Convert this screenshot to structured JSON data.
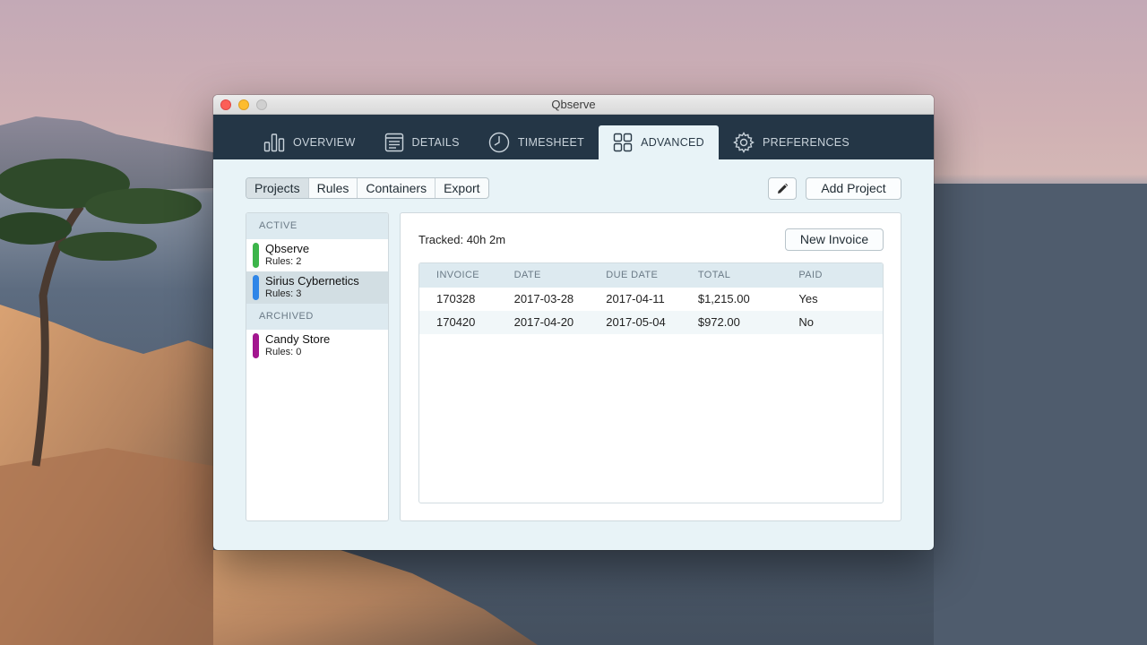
{
  "window": {
    "title": "Qbserve"
  },
  "nav": {
    "tabs": [
      {
        "label": "OVERVIEW",
        "icon": "bar-chart-icon"
      },
      {
        "label": "DETAILS",
        "icon": "document-list-icon"
      },
      {
        "label": "TIMESHEET",
        "icon": "clock-icon"
      },
      {
        "label": "ADVANCED",
        "icon": "grid-icon"
      },
      {
        "label": "PREFERENCES",
        "icon": "gear-icon"
      }
    ],
    "active": "ADVANCED"
  },
  "segments": {
    "items": [
      "Projects",
      "Rules",
      "Containers",
      "Export"
    ],
    "active": "Projects"
  },
  "toolbar": {
    "edit_icon": "pencil-icon",
    "add_project_label": "Add Project"
  },
  "sidebar": {
    "active_header": "ACTIVE",
    "archived_header": "ARCHIVED",
    "active_projects": [
      {
        "name": "Qbserve",
        "rules": "Rules: 2",
        "color": "#3cb54a"
      },
      {
        "name": "Sirius Cybernetics",
        "rules": "Rules: 3",
        "color": "#2f86e8"
      }
    ],
    "archived_projects": [
      {
        "name": "Candy Store",
        "rules": "Rules: 0",
        "color": "#a3168f"
      }
    ],
    "selected": "Sirius Cybernetics"
  },
  "panel": {
    "tracked": "Tracked: 40h 2m",
    "new_invoice_label": "New Invoice",
    "columns": [
      "INVOICE",
      "DATE",
      "DUE DATE",
      "TOTAL",
      "PAID"
    ],
    "rows": [
      [
        "170328",
        "2017-03-28",
        "2017-04-11",
        "$1,215.00",
        "Yes"
      ],
      [
        "170420",
        "2017-04-20",
        "2017-05-04",
        "$972.00",
        "No"
      ]
    ]
  },
  "colors": {
    "navbar": "#243646",
    "content_bg": "#e8f3f7"
  }
}
